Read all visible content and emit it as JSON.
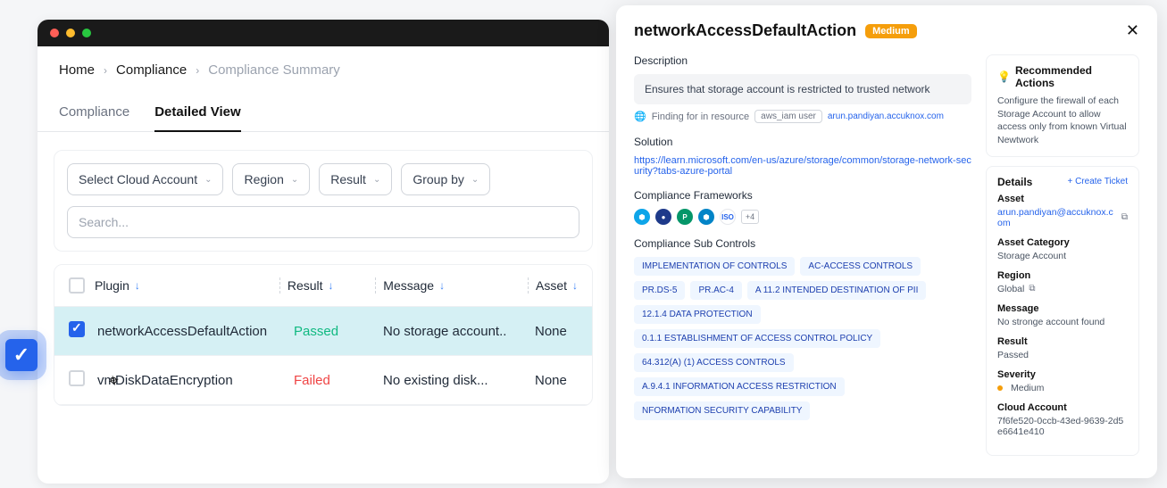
{
  "breadcrumb": {
    "home": "Home",
    "compliance": "Compliance",
    "summary": "Compliance Summary"
  },
  "tabs": {
    "compliance": "Compliance",
    "detailed": "Detailed View"
  },
  "filters": {
    "account": "Select Cloud Account",
    "region": "Region",
    "result": "Result",
    "groupby": "Group by",
    "search_placeholder": "Search..."
  },
  "table": {
    "headers": {
      "plugin": "Plugin",
      "result": "Result",
      "message": "Message",
      "asset": "Asset"
    },
    "rows": [
      {
        "plugin": "networkAccessDefaultAction",
        "result": "Passed",
        "result_class": "passed",
        "message": "No storage account..",
        "asset": "None",
        "checked": true
      },
      {
        "plugin": "vmDiskDataEncryption",
        "result": "Failed",
        "result_class": "failed",
        "message": "No existing disk...",
        "asset": "None",
        "checked": false
      }
    ]
  },
  "panel": {
    "title": "networkAccessDefaultAction",
    "severity_badge": "Medium",
    "description_label": "Description",
    "description": "Ensures that storage account is restricted to trusted network",
    "finding_prefix": "Finding for in resource",
    "finding_tag": "aws_iam user",
    "finding_link": "arun.pandiyan.accuknox.com",
    "solution_label": "Solution",
    "solution_link": "https://learn.microsoft.com/en-us/azure/storage/common/storage-network-security?tabs-azure-portal",
    "frameworks_label": "Compliance Frameworks",
    "frameworks_more": "+4",
    "subcontrols_label": "Compliance Sub Controls",
    "subcontrols": [
      "IMPLEMENTATION OF CONTROLS",
      "AC-ACCESS CONTROLS",
      "PR.DS-5",
      "PR.AC-4",
      "A 11.2 INTENDED DESTINATION OF PII",
      "12.1.4 DATA PROTECTION",
      "0.1.1 ESTABLISHMENT OF ACCESS CONTROL POLICY",
      "64.312(A) (1) ACCESS CONTROLS",
      "A.9.4.1 INFORMATION ACCESS RESTRICTION",
      "NFORMATION SECURITY CAPABILITY"
    ],
    "recommended": {
      "title": "Recommended Actions",
      "text": "Configure the firewall of each Storage Account to allow access only from known Virtual Newtwork"
    },
    "details": {
      "title": "Details",
      "create_ticket": "+ Create Ticket",
      "asset_label": "Asset",
      "asset_value": "arun.pandiyan@accuknox.com",
      "category_label": "Asset Category",
      "category_value": "Storage Account",
      "region_label": "Region",
      "region_value": "Global",
      "message_label": "Message",
      "message_value": "No stronge account found",
      "result_label": "Result",
      "result_value": "Passed",
      "severity_label": "Severity",
      "severity_value": "Medium",
      "cloud_label": "Cloud Account",
      "cloud_value": "7f6fe520-0ccb-43ed-9639-2d5e6641e410"
    }
  }
}
